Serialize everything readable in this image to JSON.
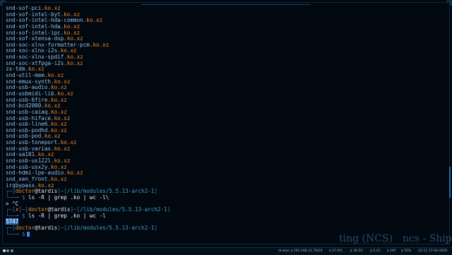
{
  "terminal": {
    "file_lines": [
      {
        "name": "snd-sof-pci",
        "ext": ".ko.xz"
      },
      {
        "name": "snd-sof-intel-byt",
        "ext": ".ko.xz"
      },
      {
        "name": "snd-sof-intel-hda-common",
        "ext": ".ko.xz"
      },
      {
        "name": "snd-sof-intel-hda",
        "ext": ".ko.xz"
      },
      {
        "name": "snd-sof-intel-ipc",
        "ext": ".ko.xz"
      },
      {
        "name": "snd-sof-xtensa-dsp",
        "ext": ".ko.xz"
      },
      {
        "name": "snd-soc-xlnx-formatter-pcm",
        "ext": ".ko.xz"
      },
      {
        "name": "snd-soc-xlnx-i2s",
        "ext": ".ko.xz"
      },
      {
        "name": "snd-soc-xlnx-spdif",
        "ext": ".ko.xz"
      },
      {
        "name": "snd-soc-xtfpga-i2s",
        "ext": ".ko.xz"
      },
      {
        "name": "zx-tdm",
        "ext": ".ko.xz"
      },
      {
        "name": "snd-util-mem",
        "ext": ".ko.xz"
      },
      {
        "name": "snd-emux-synth",
        "ext": ".ko.xz"
      },
      {
        "name": "snd-usb-audio",
        "ext": ".ko.xz"
      },
      {
        "name": "snd-usbmidi-lib",
        "ext": ".ko.xz"
      },
      {
        "name": "snd-usb-6fire",
        "ext": ".ko.xz"
      },
      {
        "name": "snd-bcd2000",
        "ext": ".ko.xz"
      },
      {
        "name": "snd-usb-caiaq",
        "ext": ".ko.xz"
      },
      {
        "name": "snd-usb-hiface",
        "ext": ".ko.xz"
      },
      {
        "name": "snd-usb-line6",
        "ext": ".ko.xz"
      },
      {
        "name": "snd-usb-podhd",
        "ext": ".ko.xz"
      },
      {
        "name": "snd-usb-pod",
        "ext": ".ko.xz"
      },
      {
        "name": "snd-usb-toneport",
        "ext": ".ko.xz"
      },
      {
        "name": "snd-usb-variax",
        "ext": ".ko.xz"
      },
      {
        "name": "snd-ua101",
        "ext": ".ko.xz"
      },
      {
        "name": "snd-usb-us122l",
        "ext": ".ko.xz"
      },
      {
        "name": "snd-usb-usx2y",
        "ext": ".ko.xz"
      },
      {
        "name": "snd-hdmi-lpe-audio",
        "ext": ".ko.xz"
      },
      {
        "name": "snd_xen_front",
        "ext": ".ko.xz"
      },
      {
        "name": "irqbypass",
        "ext": ".ko.xz"
      }
    ],
    "prompt1": {
      "open": "┌─[",
      "user": "doctor",
      "at": "@",
      "host": "tardis",
      "mid": "]─[",
      "path": "/lib/modules/5.5.13-arch2-1",
      "close": "]",
      "arrow": "└──╼ $",
      "command": "ls -R | grep .ko | wc -l\\",
      "continuation": "> ^C"
    },
    "prompt2": {
      "open": "┌─[",
      "status": "✗",
      "mid1": "]─[",
      "user": "doctor",
      "at": "@",
      "host": "tardis",
      "mid2": "]─[",
      "path": "/lib/modules/5.5.13-arch2-1",
      "close": "]",
      "arrow": "└──╼ $",
      "command": "ls -R | grep .ko | wc -l",
      "output": "5747"
    },
    "prompt3": {
      "open": "┌─[",
      "user": "doctor",
      "at": "@",
      "host": "tardis",
      "mid": "]─[",
      "path": "/lib/modules/5.5.13-arch2-1",
      "close": "]",
      "arrow": "└──╼ $"
    }
  },
  "background_text": {
    "part1": "ting (NCS)",
    "part2": "ncs - Ship W"
  },
  "statusbar": {
    "wifi_label": "wlan",
    "ip": "192.168.31.79/24",
    "disk": "27.0%",
    "mem": "28.5G",
    "load": "4.1G",
    "temp": "19C",
    "battery": "55%",
    "datetime": "21:11 17-04-2020"
  },
  "colors": {
    "accent": "#2f8fe8",
    "extension": "#f08a2c",
    "text": "#8fc1ee",
    "background": "#02080f"
  }
}
